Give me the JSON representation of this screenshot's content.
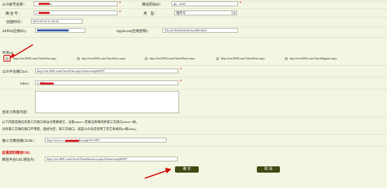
{
  "form": {
    "account_name": {
      "label": "公众帐号名称：",
      "value": "ar"
    },
    "wechat_raw_id": {
      "label": "微信原始ID：",
      "value": "gh_              rnz6f"
    },
    "wechat_id": {
      "label": "微 信 号 ：",
      "value": "u"
    },
    "type": {
      "label": "类　型：",
      "value": "服务号"
    },
    "created_time": {
      "label": "创建时间 ：",
      "value": "2015-05-25 11:28:10"
    },
    "appid": {
      "label": "APPID(应用ID)：",
      "value": ""
    },
    "appsecret": {
      "label": "AppSecret(应用密钥)：",
      "value": "52bc4110fd25e9e4a16ec88f16b32"
    },
    "options_label": "可选url",
    "options": [
      "http://test.883l.com/CheckOne.aspx",
      "http://test.883l.com/CheckTwo.aspx",
      "http://test.883l.com/CheckThree.aspx",
      "http://test.883l.com/CheckFour.aspx",
      "http://test.883l.com/CheckSignate.aspx"
    ],
    "public_url": {
      "label": "公众平台接口url：",
      "value": "http://test.883l.com/CheckOne.aspx?token=uzq6d5387"
    },
    "token": {
      "label": "token：",
      "value": "u        387"
    },
    "custom_reply": {
      "label": "自定义恢复内容：",
      "value": ""
    },
    "notice_1": "以下内容是微信有第三方接口地址才需要填写，注意token一定要与原来的原第三方接口token一样。",
    "notice_2": "没有第三方微信接口不用管，直接为空，第三方接口，就是公众号还有用了其它系统的url和token。",
    "third_party_url": {
      "label": "第三方微信接口URL：",
      "value": "http://www.w              .com/wp/index.php?id=5387"
    },
    "callback_title": "此是您的微信URL",
    "callback_url": {
      "label": "微信平台URL地址为：",
      "value": "http://test.883l.com/CheckThirdInterface.aspx?token=uzq6d5387"
    }
  },
  "buttons": {
    "confirm": "确 定",
    "cancel": "取 消"
  },
  "colors": {
    "accent_red": "#d40000",
    "button_bg": "#3f4a14",
    "page_bg": "#f3f6e2"
  }
}
